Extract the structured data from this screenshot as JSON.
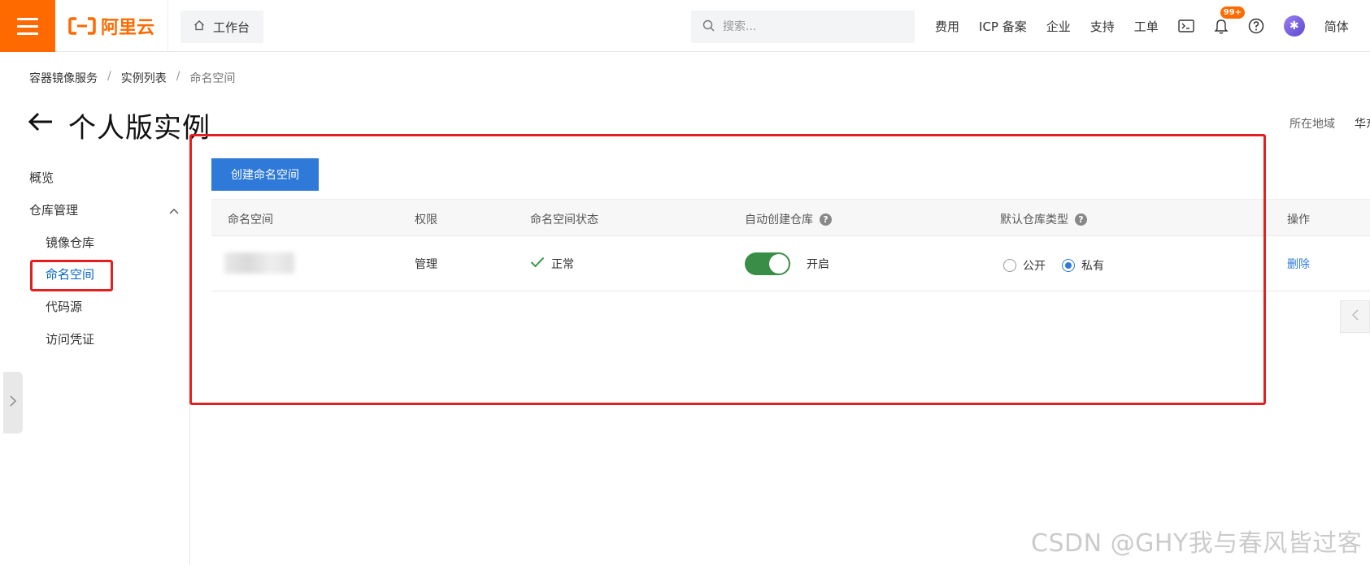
{
  "topbar": {
    "logo_text": "阿里云",
    "workbench_label": "工作台",
    "search_placeholder": "搜索...",
    "nav": [
      "费用",
      "ICP 备案",
      "企业",
      "支持",
      "工单"
    ],
    "notification_badge": "99+",
    "language": "简体",
    "accent_color": "#ff6a00"
  },
  "breadcrumb": {
    "items": [
      "容器镜像服务",
      "实例列表",
      "命名空间"
    ],
    "separator": "/"
  },
  "page": {
    "title": "个人版实例",
    "region_label": "所在地域",
    "region_value": "华东"
  },
  "sidebar": {
    "overview": "概览",
    "repo_mgmt": "仓库管理",
    "items": [
      "镜像仓库",
      "命名空间",
      "代码源",
      "访问凭证"
    ],
    "active_item": "命名空间"
  },
  "main": {
    "create_button": "创建命名空间",
    "columns": [
      "命名空间",
      "权限",
      "命名空间状态",
      "自动创建仓库",
      "默认仓库类型",
      "操作"
    ],
    "rows": [
      {
        "namespace": "",
        "permission": "管理",
        "status": "正常",
        "auto_create": "开启",
        "auto_create_on": true,
        "repo_type_options": [
          "公开",
          "私有"
        ],
        "repo_type_selected": "私有",
        "action": "删除"
      }
    ]
  },
  "watermark": "CSDN @GHY我与春风皆过客",
  "colors": {
    "primary_blue": "#2f7ad8",
    "highlight_red": "#e41f1f",
    "toggle_green": "#3a8d46"
  }
}
